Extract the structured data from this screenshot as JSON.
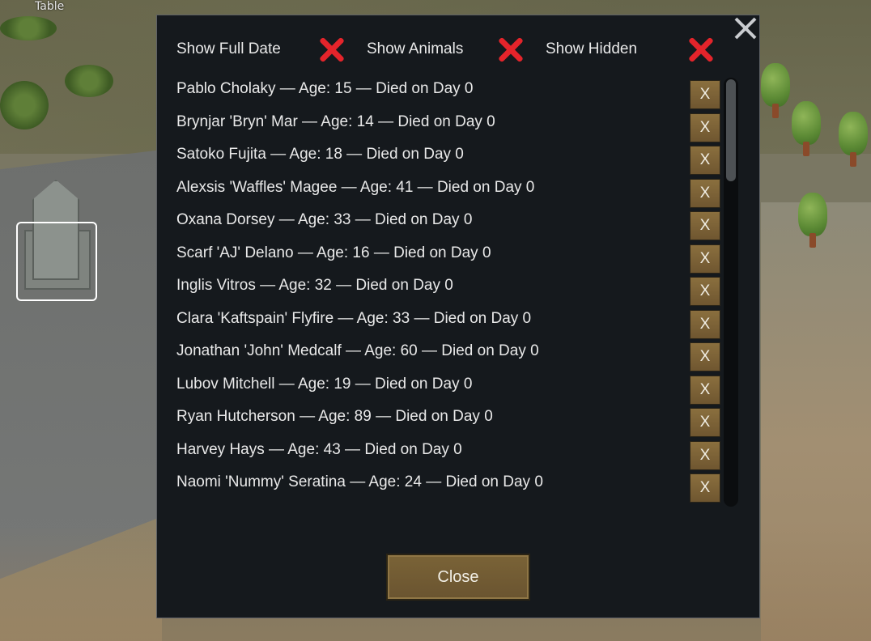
{
  "map": {
    "table_label": "Table"
  },
  "dialog": {
    "toggles": [
      {
        "label": "Show Full Date",
        "state": "off",
        "icon": "red-x-icon"
      },
      {
        "label": "Show Animals",
        "state": "off",
        "icon": "red-x-icon"
      },
      {
        "label": "Show Hidden",
        "state": "off",
        "icon": "red-x-icon"
      }
    ],
    "entries": [
      {
        "text": "Pablo Cholaky — Age: 15 — Died on Day 0"
      },
      {
        "text": "Brynjar 'Bryn' Mar — Age: 14 — Died on Day 0"
      },
      {
        "text": "Satoko Fujita — Age: 18 — Died on Day 0"
      },
      {
        "text": "Alexsis 'Waffles' Magee — Age: 41 — Died on Day 0"
      },
      {
        "text": "Oxana Dorsey — Age: 33 — Died on Day 0"
      },
      {
        "text": "Scarf 'AJ' Delano — Age: 16 — Died on Day 0"
      },
      {
        "text": "Inglis Vitros — Age: 32 — Died on Day 0"
      },
      {
        "text": "Clara 'Kaftspain' Flyfire — Age: 33 — Died on Day 0"
      },
      {
        "text": "Jonathan 'John' Medcalf — Age: 60 — Died on Day 0"
      },
      {
        "text": "Lubov Mitchell — Age: 19 — Died on Day 0"
      },
      {
        "text": "Ryan Hutcherson — Age: 89 — Died on Day 0"
      },
      {
        "text": "Harvey Hays — Age: 43 — Died on Day 0"
      },
      {
        "text": "Naomi 'Nummy' Seratina — Age: 24 — Died on Day 0"
      }
    ],
    "delete_label": "X",
    "close_button_label": "Close",
    "colors": {
      "panel_bg": "#15191d",
      "toggle_off": "#e4242b",
      "button_brown": "#7a6337"
    }
  }
}
